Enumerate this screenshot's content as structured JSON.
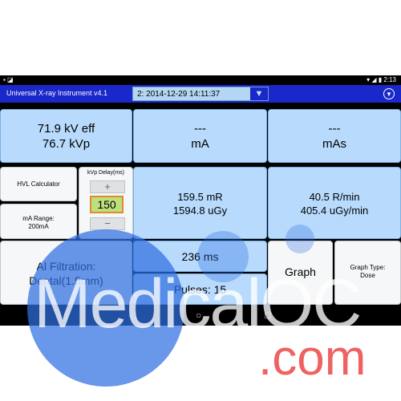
{
  "status": {
    "left_icons": "▪ ◪",
    "time": "2:13",
    "right_icons": "▾ ◢ ▮"
  },
  "app": {
    "title": "Universal X-ray Instrument v4.1",
    "session": "2: 2014-12-29 14:11:37"
  },
  "tiles": {
    "kv_eff": "71.9 kV eff",
    "kvp": "76.7 kVp",
    "ma_value": "---",
    "ma_unit": "mA",
    "mas_value": "---",
    "mas_unit": "mAs",
    "hvl_label": "HVL Calculator",
    "ma_range_label": "mA Range:",
    "ma_range_value": "200mA",
    "kvp_delay_label": "kVp Delay(ms)",
    "kvp_delay_value": "150",
    "plus": "+",
    "minus": "−",
    "dose_mr": "159.5 mR",
    "dose_ugy": "1594.8 uGy",
    "rate_rmin": "40.5 R/min",
    "rate_ugys": "405.4 uGy/min",
    "filtration_label": "Al Filtration:",
    "filtration_value": "Dental(1.5mm)",
    "time_ms": "236 ms",
    "pulses": "Pulses: 15",
    "graph": "Graph",
    "graph_type_label": "Graph Type:",
    "graph_type_value": "Dose"
  },
  "nav": {
    "back": "◁",
    "home": "○",
    "recents": "□"
  },
  "watermark": {
    "main": "MedicalQC",
    "sub": ".com"
  },
  "colors": {
    "appbar": "#1a27c9",
    "tile": "#b8dafd",
    "watermark_blue": "#2f6fe0",
    "watermark_red": "#ef6262"
  }
}
